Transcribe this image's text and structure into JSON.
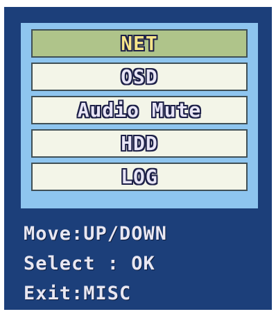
{
  "menu": {
    "items": [
      {
        "label": "NET",
        "selected": true
      },
      {
        "label": "OSD",
        "selected": false
      },
      {
        "label": "Audio Mute",
        "selected": false
      },
      {
        "label": "HDD",
        "selected": false
      },
      {
        "label": "LOG",
        "selected": false
      }
    ]
  },
  "help": {
    "move": "Move:UP/DOWN",
    "select": "Select : OK",
    "exit": "Exit:MISC"
  },
  "colors": {
    "screen_background": "#1c3f7a",
    "frame": "#8ec5ef",
    "item_background": "#f3f5e8",
    "selected_item_background": "#afc48a",
    "selected_label": "#f6e48a"
  }
}
